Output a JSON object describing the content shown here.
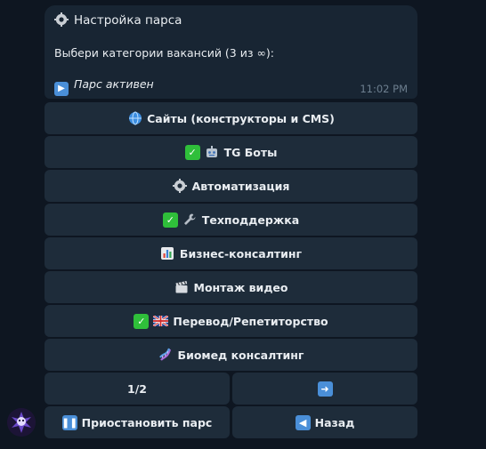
{
  "message": {
    "title": "Настройка парса",
    "text": "Выбери категории вакансий (3 из ∞):",
    "status": "Парс активен",
    "time": "11:02 PM",
    "icons": {
      "title": "gear-icon",
      "status": "play-icon"
    }
  },
  "keyboard": {
    "buttons": [
      {
        "label": "Сайты (конструкторы и CMS)",
        "icons": [
          "globe-icon"
        ]
      },
      {
        "label": "TG Боты",
        "icons": [
          "check-icon",
          "robot-icon"
        ]
      },
      {
        "label": "Автоматизация",
        "icons": [
          "gear-icon"
        ]
      },
      {
        "label": "Техподдержка",
        "icons": [
          "check-icon",
          "wrench-icon"
        ]
      },
      {
        "label": "Бизнес-консалтинг",
        "icons": [
          "bar-chart-icon"
        ]
      },
      {
        "label": "Монтаж видео",
        "icons": [
          "clapper-icon"
        ]
      },
      {
        "label": "Перевод/Репетиторство",
        "icons": [
          "check-icon",
          "uk-flag-icon"
        ]
      },
      {
        "label": "Биомед консалтинг",
        "icons": [
          "dna-icon"
        ]
      }
    ],
    "pagination": {
      "page": "1/2",
      "next_icon": "right-arrow-icon"
    },
    "pause_label": "Приостановить парс",
    "back_label": "Назад",
    "pause_icon": "pause-icon",
    "back_icon": "left-arrow-icon"
  },
  "colors": {
    "background": "#0e1621",
    "bubble": "#182533",
    "button": "#1e2c3a",
    "time": "#6d7f8f",
    "check": "#2fbf3a"
  }
}
